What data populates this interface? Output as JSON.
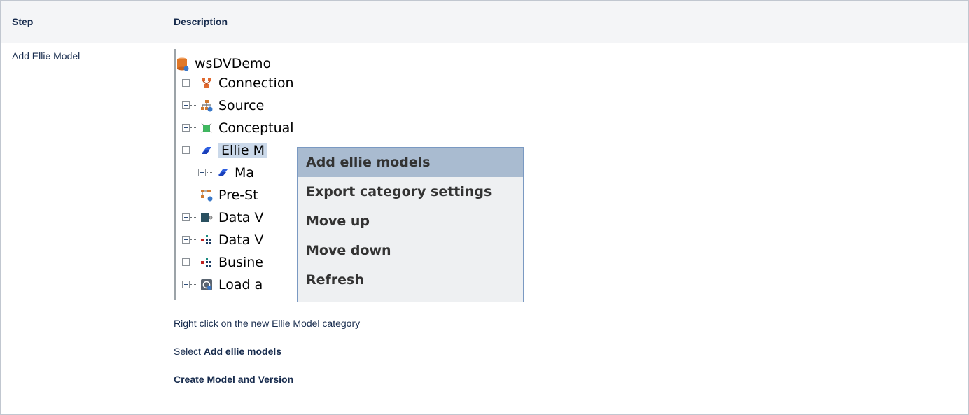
{
  "table": {
    "header_step": "Step",
    "header_description": "Description",
    "row_step": "Add Ellie Model",
    "line1": "Right click on the new Ellie Model category",
    "line2_prefix": "Select ",
    "line2_bold": "Add ellie models",
    "line3": "Create Model and Version"
  },
  "tree": {
    "root": "wsDVDemo",
    "items": [
      {
        "label": "Connection",
        "icon": "connection-icon"
      },
      {
        "label": "Source",
        "icon": "source-icon"
      },
      {
        "label": "Conceptual",
        "icon": "conceptual-icon"
      },
      {
        "label": "Ellie M",
        "icon": "ellie-model-icon"
      },
      {
        "label": "Ma",
        "icon": "ellie-model-icon"
      },
      {
        "label": "Pre-St",
        "icon": "pre-staging-icon"
      },
      {
        "label": "Data V",
        "icon": "data-vault-icon"
      },
      {
        "label": "Data V",
        "icon": "data-vault-tree-icon"
      },
      {
        "label": "Busine",
        "icon": "business-icon"
      },
      {
        "label": "Load a",
        "icon": "load-icon"
      }
    ]
  },
  "menu": {
    "items": [
      "Add ellie models",
      "Export category settings",
      "Move up",
      "Move down",
      "Refresh"
    ]
  },
  "colors": {
    "selection": "#cbd9ea",
    "menu_highlight": "#a9bbd0",
    "menu_bg": "#eef0f2"
  }
}
